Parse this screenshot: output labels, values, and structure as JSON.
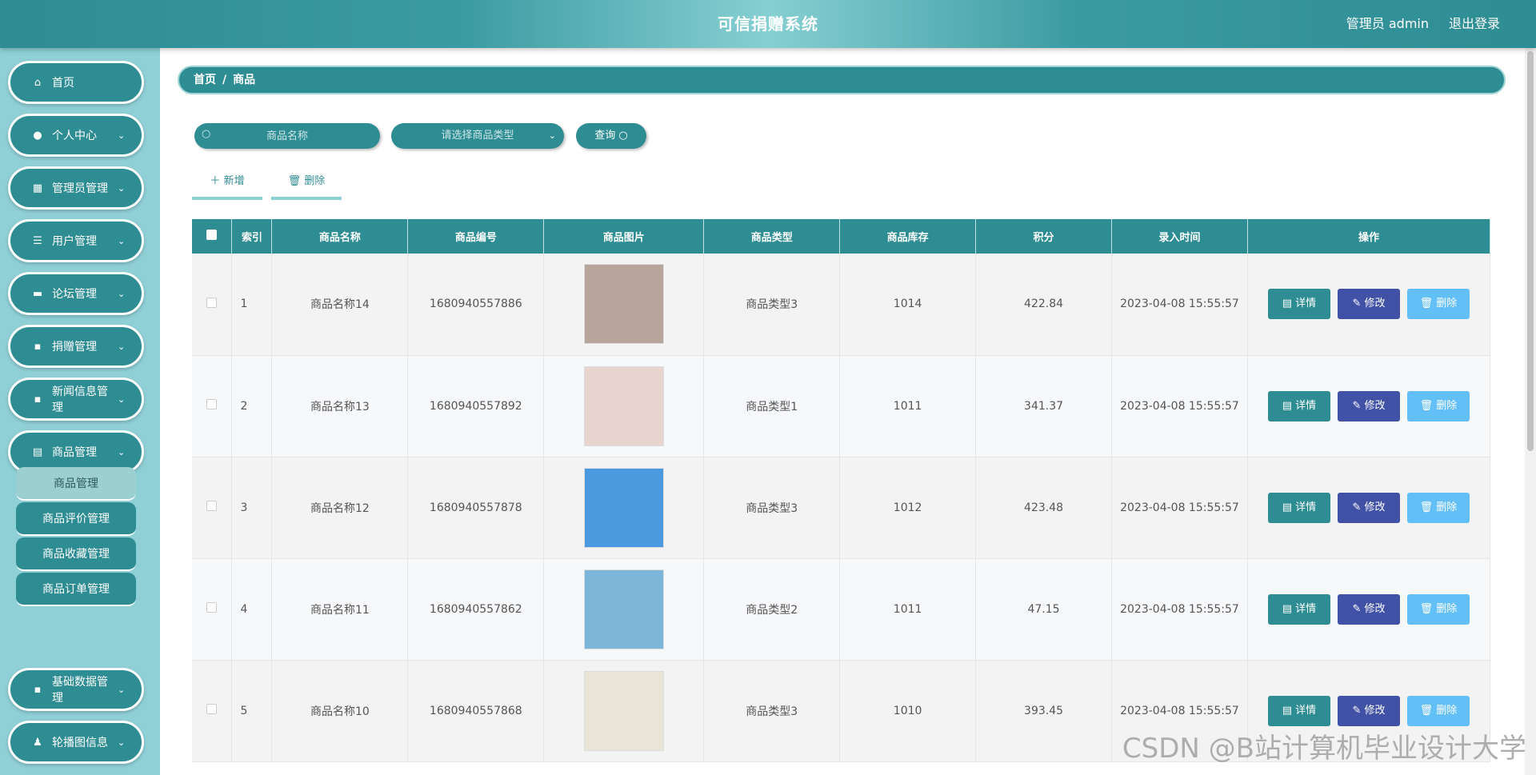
{
  "header": {
    "title": "可信捐赠系统",
    "user": "管理员 admin",
    "logout": "退出登录"
  },
  "sidebar": {
    "items": [
      {
        "label": "首页",
        "icon": "home-icon"
      },
      {
        "label": "个人中心",
        "icon": "user-icon"
      },
      {
        "label": "管理员管理",
        "icon": "grid-icon"
      },
      {
        "label": "用户管理",
        "icon": "list-icon"
      },
      {
        "label": "论坛管理",
        "icon": "chat-icon"
      },
      {
        "label": "捐赠管理",
        "icon": "apps-icon"
      },
      {
        "label": "新闻信息管理",
        "icon": "apps-icon"
      },
      {
        "label": "商品管理",
        "icon": "clipboard-icon"
      },
      {
        "label": "基础数据管理",
        "icon": "apps-icon"
      },
      {
        "label": "轮播图信息",
        "icon": "person-icon"
      }
    ],
    "submenu": [
      "商品管理",
      "商品评价管理",
      "商品收藏管理",
      "商品订单管理"
    ]
  },
  "breadcrumb": {
    "home": "首页",
    "current": "商品"
  },
  "search": {
    "name_placeholder": "商品名称",
    "type_placeholder": "请选择商品类型",
    "query_label": "查询"
  },
  "actions": {
    "add_label": "新增",
    "delete_label": "删除"
  },
  "table": {
    "headers": [
      "索引",
      "商品名称",
      "商品编号",
      "商品图片",
      "商品类型",
      "商品库存",
      "积分",
      "录入时间",
      "操作"
    ],
    "op_labels": {
      "detail": "详情",
      "edit": "修改",
      "delete": "删除"
    },
    "rows": [
      {
        "index": "1",
        "name": "商品名称14",
        "code": "1680940557886",
        "type": "商品类型3",
        "stock": "1014",
        "points": "422.84",
        "time": "2023-04-08 15:55:57",
        "img_color": "#b7a49c"
      },
      {
        "index": "2",
        "name": "商品名称13",
        "code": "1680940557892",
        "type": "商品类型1",
        "stock": "1011",
        "points": "341.37",
        "time": "2023-04-08 15:55:57",
        "img_color": "#e8d5cf"
      },
      {
        "index": "3",
        "name": "商品名称12",
        "code": "1680940557878",
        "type": "商品类型3",
        "stock": "1012",
        "points": "423.48",
        "time": "2023-04-08 15:55:57",
        "img_color": "#4b9ae0"
      },
      {
        "index": "4",
        "name": "商品名称11",
        "code": "1680940557862",
        "type": "商品类型2",
        "stock": "1011",
        "points": "47.15",
        "time": "2023-04-08 15:55:57",
        "img_color": "#7cb6d8"
      },
      {
        "index": "5",
        "name": "商品名称10",
        "code": "1680940557868",
        "type": "商品类型3",
        "stock": "1010",
        "points": "393.45",
        "time": "2023-04-08 15:55:57",
        "img_color": "#e9e4d8"
      }
    ]
  },
  "watermark": "CSDN @B站计算机毕业设计大学"
}
